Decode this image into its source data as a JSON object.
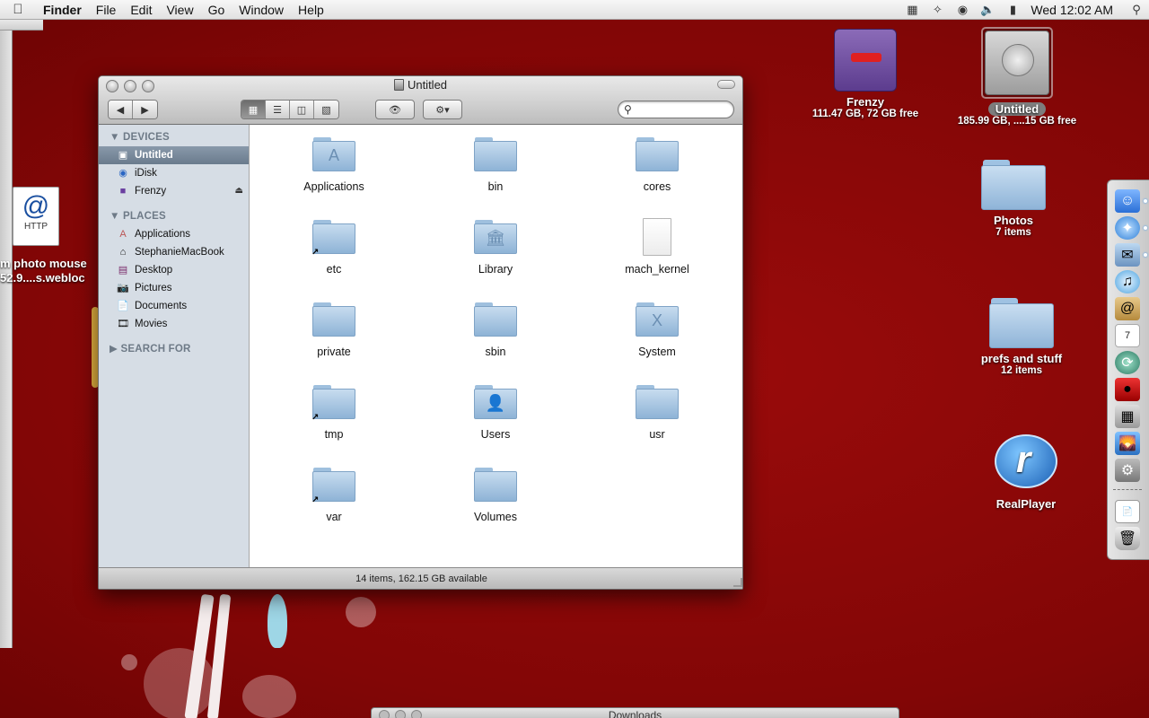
{
  "menubar": {
    "apple_icon": "apple-icon",
    "items": [
      "Finder",
      "File",
      "Edit",
      "View",
      "Go",
      "Window",
      "Help"
    ],
    "clock": "Wed 12:02 AM"
  },
  "desktop": {
    "icons": [
      {
        "name": "Frenzy",
        "sub": "111.47 GB, 72 GB free"
      },
      {
        "name": "Untitled",
        "sub": "185.99 GB, ....15 GB free"
      },
      {
        "name": "Photos",
        "sub": "7 items"
      },
      {
        "name": "prefs and stuff",
        "sub": "12 items"
      },
      {
        "name": "RealPlayer",
        "sub": ""
      }
    ],
    "http_icon": {
      "label": "HTTP",
      "name_line1": "m photo mouse",
      "name_line2": "52.9....s.webloc"
    }
  },
  "finder": {
    "title": "Untitled",
    "search_placeholder": "",
    "sidebar": {
      "devices_heading": "DEVICES",
      "devices": [
        {
          "label": "Untitled",
          "icon": "hard-drive-icon",
          "selected": true
        },
        {
          "label": "iDisk",
          "icon": "idisk-icon",
          "selected": false
        },
        {
          "label": "Frenzy",
          "icon": "disk-icon",
          "selected": false
        }
      ],
      "places_heading": "PLACES",
      "places": [
        {
          "label": "Applications",
          "icon": "applications-icon"
        },
        {
          "label": "StephanieMacBook",
          "icon": "home-icon"
        },
        {
          "label": "Desktop",
          "icon": "desktop-icon"
        },
        {
          "label": "Pictures",
          "icon": "pictures-icon"
        },
        {
          "label": "Documents",
          "icon": "documents-icon"
        },
        {
          "label": "Movies",
          "icon": "movies-icon"
        }
      ],
      "search_heading": "SEARCH FOR"
    },
    "items": [
      {
        "label": "Applications",
        "kind": "folder",
        "glyph": "A",
        "alias": false
      },
      {
        "label": "bin",
        "kind": "folder",
        "glyph": "",
        "alias": false
      },
      {
        "label": "cores",
        "kind": "folder",
        "glyph": "",
        "alias": false
      },
      {
        "label": "etc",
        "kind": "folder",
        "glyph": "",
        "alias": true
      },
      {
        "label": "Library",
        "kind": "folder",
        "glyph": "🏛",
        "alias": false
      },
      {
        "label": "mach_kernel",
        "kind": "document",
        "glyph": "",
        "alias": false
      },
      {
        "label": "private",
        "kind": "folder",
        "glyph": "",
        "alias": false
      },
      {
        "label": "sbin",
        "kind": "folder",
        "glyph": "",
        "alias": false
      },
      {
        "label": "System",
        "kind": "folder",
        "glyph": "X",
        "alias": false
      },
      {
        "label": "tmp",
        "kind": "folder",
        "glyph": "",
        "alias": true
      },
      {
        "label": "Users",
        "kind": "folder",
        "glyph": "👤",
        "alias": false
      },
      {
        "label": "usr",
        "kind": "folder",
        "glyph": "",
        "alias": false
      },
      {
        "label": "var",
        "kind": "folder",
        "glyph": "",
        "alias": true
      },
      {
        "label": "Volumes",
        "kind": "folder",
        "glyph": "",
        "alias": false
      }
    ],
    "status": "14 items, 162.15 GB available"
  },
  "dock": {
    "items": [
      "finder-icon",
      "safari-icon",
      "mail-icon",
      "itunes-icon",
      "address-book-icon",
      "ical-icon",
      "time-machine-icon",
      "photo-booth-icon",
      "calculator-icon",
      "iphoto-icon",
      "system-preferences-icon",
      "documents-stack-icon",
      "trash-icon"
    ]
  },
  "bottom_window": {
    "title": "Downloads"
  }
}
